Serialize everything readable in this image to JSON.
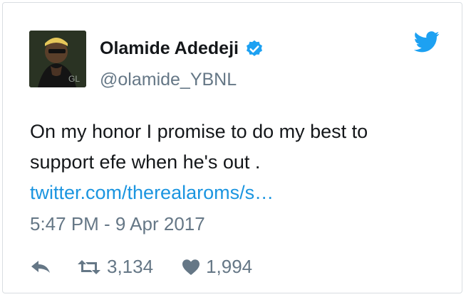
{
  "user": {
    "name": "Olamide Adedeji",
    "handle": "@olamide_YBNL",
    "avatar_caption": "GL"
  },
  "tweet": {
    "text_line": "On my honor I promise to do my best to support efe when he's out . ",
    "link_text": "twitter.com/therealaroms/s…",
    "timestamp": "5:47  PM - 9 Apr 2017"
  },
  "actions": {
    "retweets": "3,134",
    "likes": "1,994"
  },
  "colors": {
    "accent": "#1b95e0",
    "muted": "#657786",
    "text": "#14171a",
    "verified": "#1da1f2"
  },
  "icons": {
    "verified": "verified-badge-icon",
    "bird": "twitter-bird-icon",
    "reply": "reply-icon",
    "retweet": "retweet-icon",
    "like": "heart-icon"
  }
}
